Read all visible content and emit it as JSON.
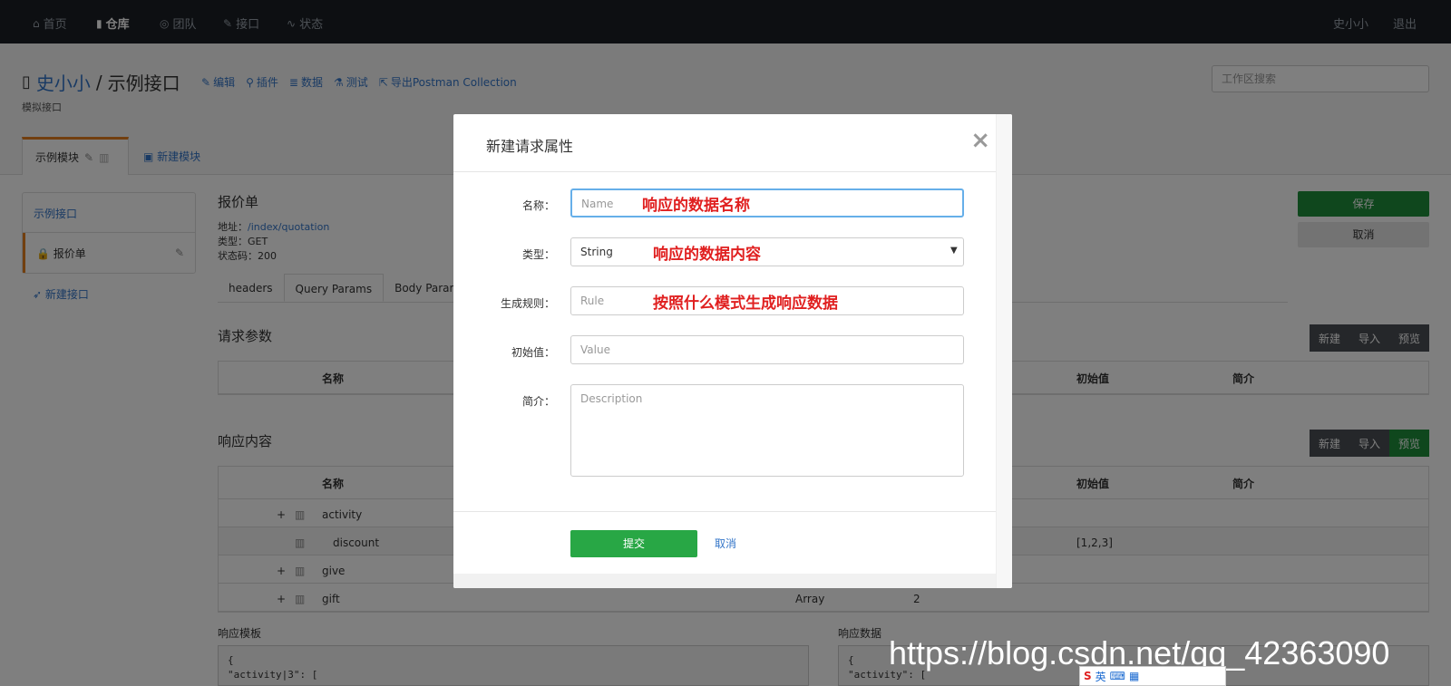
{
  "nav": {
    "items": [
      {
        "label": "首页",
        "icon": "home-icon"
      },
      {
        "label": "仓库",
        "icon": "book-icon"
      },
      {
        "label": "团队",
        "icon": "team-icon"
      },
      {
        "label": "接口",
        "icon": "wrench-icon"
      },
      {
        "label": "状态",
        "icon": "pulse-icon"
      }
    ],
    "user": "史小小",
    "logout": "退出"
  },
  "repo": {
    "owner": "史小小",
    "separator": "/",
    "name": "示例接口",
    "subtitle": "模拟接口",
    "actions": [
      "编辑",
      "插件",
      "数据",
      "测试",
      "导出Postman Collection"
    ],
    "search_placeholder": "工作区搜索"
  },
  "modules": {
    "active": "示例模块",
    "new": "新建模块"
  },
  "sidebar": {
    "first": "示例接口",
    "selected": "报价单",
    "new": "新建接口"
  },
  "interface": {
    "title": "报价单",
    "addr_label": "地址：",
    "addr": "/index/quotation",
    "type_label": "类型：",
    "type": "GET",
    "status_label": "状态码：",
    "status": "200"
  },
  "subtabs": [
    "headers",
    "Query Params",
    "Body Param"
  ],
  "request": {
    "title": "请求参数",
    "btns": [
      "新建",
      "导入",
      "预览"
    ],
    "cols": [
      "名称",
      "初始值",
      "简介"
    ]
  },
  "response": {
    "title": "响应内容",
    "btns": [
      "新建",
      "导入",
      "预览"
    ],
    "cols": [
      "名称",
      "初始值",
      "简介"
    ],
    "rows": [
      {
        "name": "activity",
        "value": "",
        "type": ""
      },
      {
        "name": "discount",
        "value": "[1,2,3]",
        "type": ""
      },
      {
        "name": "give",
        "value": "",
        "type": ""
      },
      {
        "name": "gift",
        "value": "2",
        "type": "Array"
      }
    ]
  },
  "save": "保存",
  "cancel_side": "取消",
  "template": {
    "label": "响应模板",
    "code1": "{",
    "code2": "  \"activity|3\": ["
  },
  "data": {
    "label": "响应数据",
    "code1": "{",
    "code2": "  \"activity\": ["
  },
  "modal": {
    "title": "新建请求属性",
    "close": "×",
    "fields": {
      "name": {
        "label": "名称：",
        "placeholder": "Name",
        "note": "响应的数据名称"
      },
      "type": {
        "label": "类型：",
        "value": "String",
        "note": "响应的数据内容"
      },
      "rule": {
        "label": "生成规则：",
        "placeholder": "Rule",
        "note": "按照什么模式生成响应数据"
      },
      "value": {
        "label": "初始值：",
        "placeholder": "Value"
      },
      "desc": {
        "label": "简介：",
        "placeholder": "Description"
      }
    },
    "submit": "提交",
    "cancel": "取消"
  },
  "watermark": "https://blog.csdn.net/qq_42363090",
  "ime": {
    "label": "英"
  }
}
